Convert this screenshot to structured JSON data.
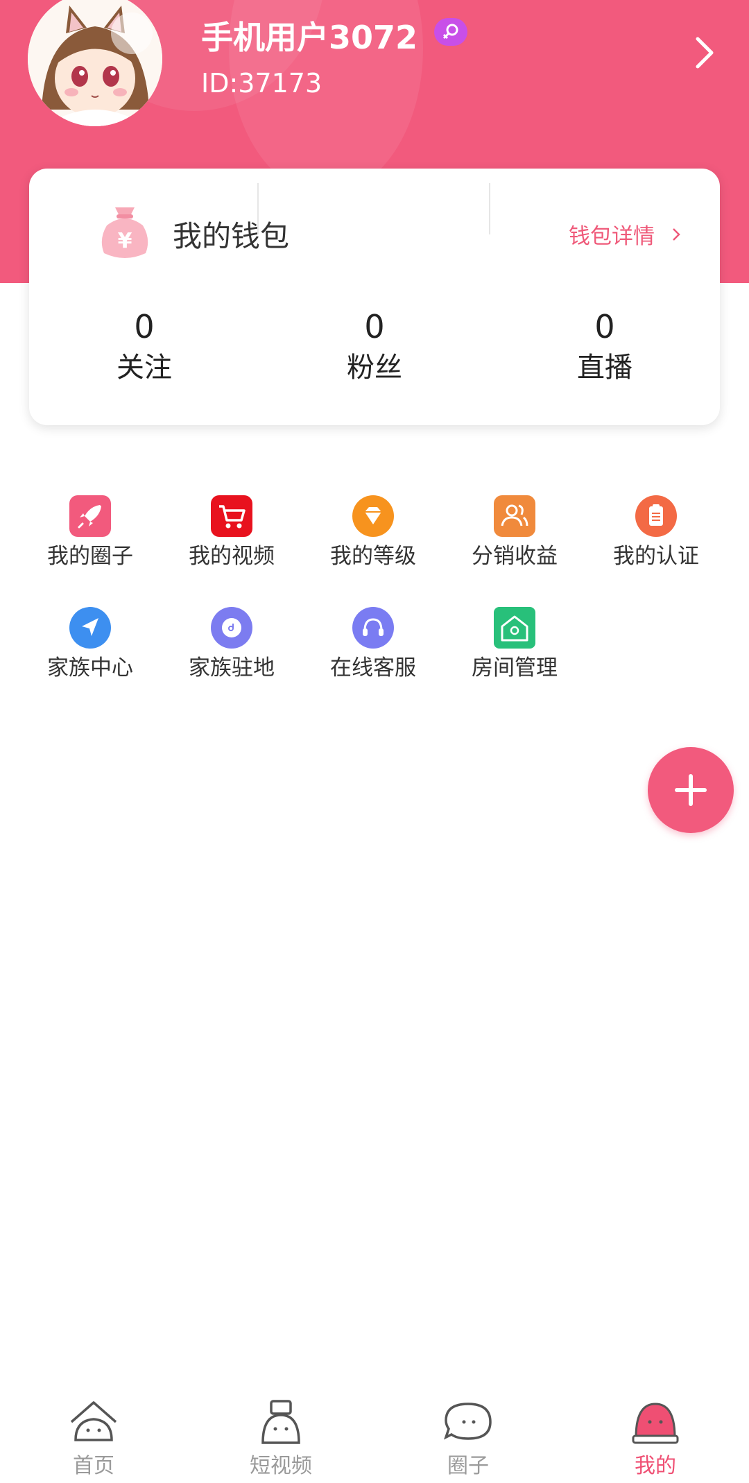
{
  "profile": {
    "username": "手机用户3072",
    "user_id": "ID:37173",
    "gender_icon": "female-symbol"
  },
  "wallet": {
    "title": "我的钱包",
    "detail_link": "钱包详情"
  },
  "stats": [
    {
      "value": "0",
      "label": "关注"
    },
    {
      "value": "0",
      "label": "粉丝"
    },
    {
      "value": "0",
      "label": "直播"
    }
  ],
  "menu": [
    {
      "label": "我的圈子",
      "icon": "rocket-icon",
      "color": "#f25a7d"
    },
    {
      "label": "我的视频",
      "icon": "cart-icon",
      "color": "#e8121e"
    },
    {
      "label": "我的等级",
      "icon": "diamond-icon",
      "color": "#f7931e"
    },
    {
      "label": "分销收益",
      "icon": "people-icon",
      "color": "#f08a3c"
    },
    {
      "label": "我的认证",
      "icon": "clipboard-icon",
      "color": "#f36a45"
    },
    {
      "label": "家族中心",
      "icon": "navigation-icon",
      "color": "#3d8ff0"
    },
    {
      "label": "家族驻地",
      "icon": "disc-icon",
      "color": "#7c7cf0"
    },
    {
      "label": "在线客服",
      "icon": "headset-icon",
      "color": "#7a7cf2"
    },
    {
      "label": "房间管理",
      "icon": "house-icon",
      "color": "#28c07a"
    }
  ],
  "tabs": [
    {
      "label": "首页",
      "icon": "home-tab-icon"
    },
    {
      "label": "短视频",
      "icon": "video-tab-icon"
    },
    {
      "label": "圈子",
      "icon": "circle-tab-icon"
    },
    {
      "label": "我的",
      "icon": "me-tab-icon",
      "active": true
    }
  ],
  "colors": {
    "brand": "#f25a7d",
    "active_tab": "#ef4f73"
  }
}
